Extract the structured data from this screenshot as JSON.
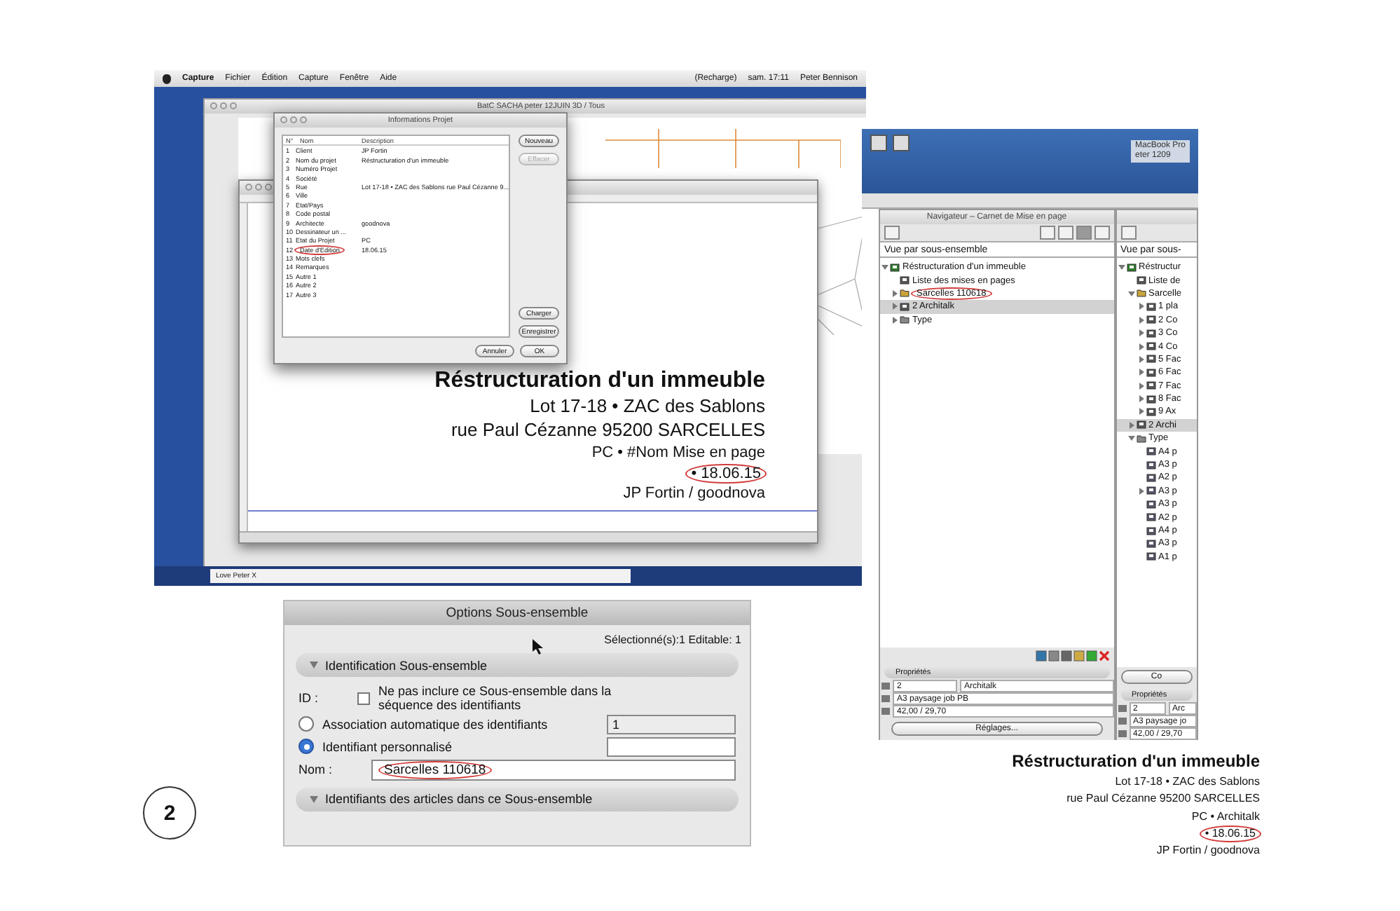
{
  "main_screenshot": {
    "menu_bar": {
      "menus": [
        "Capture",
        "Fichier",
        "Édition",
        "Capture",
        "Fenêtre",
        "Aide"
      ],
      "status": [
        "(Recharge)",
        "sam. 17:11",
        "Peter Bennison"
      ]
    },
    "back_window": {
      "title": "BatC SACHA peter 12JUIN 3D / Tous"
    },
    "info_dialog": {
      "title": "Informations Projet",
      "columns": [
        "N°",
        "Nom",
        "Description"
      ],
      "rows": [
        {
          "number": "1",
          "name": "Client",
          "description": "JP Fortin",
          "circled": false
        },
        {
          "number": "2",
          "name": "Nom du projet",
          "description": "Réstructuration d'un immeuble",
          "circled": false
        },
        {
          "number": "3",
          "name": "Numéro Projet",
          "circled": false
        },
        {
          "number": "4",
          "name": "Société",
          "circled": false
        },
        {
          "number": "5",
          "name": "Rue",
          "description": "Lot 17-18 • ZAC des Sablons rue Paul Cézanne 9...",
          "circled": false
        },
        {
          "number": "6",
          "name": "Ville",
          "circled": false
        },
        {
          "number": "7",
          "name": "Etat/Pays",
          "circled": false
        },
        {
          "number": "8",
          "name": "Code postal",
          "circled": false
        },
        {
          "number": "9",
          "name": "Architecte",
          "description": "goodnova",
          "circled": false
        },
        {
          "number": "10",
          "name": "Dessinateur un ...",
          "circled": false
        },
        {
          "number": "11",
          "name": "Etat du Projet",
          "description": "PC",
          "circled": false
        },
        {
          "number": "12",
          "name": "Date d'Edition",
          "description": "18.06.15",
          "circled": true
        },
        {
          "number": "13",
          "name": "Mots clefs",
          "circled": false
        },
        {
          "number": "14",
          "name": "Remarques",
          "circled": false
        },
        {
          "number": "15",
          "name": "Autre 1",
          "circled": false
        },
        {
          "number": "16",
          "name": "Autre 2",
          "circled": false
        },
        {
          "number": "17",
          "name": "Autre 3",
          "circled": false
        }
      ],
      "side_buttons": [
        {
          "label": "Nouveau",
          "disabled": false
        },
        {
          "label": "Effacer",
          "disabled": true
        }
      ],
      "lower_buttons": [
        {
          "label": "Charger",
          "disabled": false
        },
        {
          "label": "Enregistrer",
          "disabled": false
        }
      ],
      "footer_buttons": [
        {
          "label": "Annuler",
          "disabled": false
        },
        {
          "label": "OK",
          "disabled": false
        }
      ]
    },
    "title_block": [
      {
        "kind": "heading",
        "text": "Réstructuration d'un immeuble",
        "circled": false
      },
      {
        "kind": "line",
        "text": "Lot 17-18 • ZAC des Sablons",
        "circled": false
      },
      {
        "kind": "line",
        "text": "rue Paul Cézanne 95200 SARCELLES",
        "circled": false
      },
      {
        "kind": "small",
        "text": "PC • #Nom Mise en page",
        "circled": false
      },
      {
        "kind": "small",
        "text": "• 18.06.15",
        "circled": true
      },
      {
        "kind": "small",
        "text": "JP Fortin / goodnova",
        "circled": false
      }
    ],
    "dock_label": "Love Peter X"
  },
  "navigator_screenshot": {
    "desktop_label": [
      "MacBook Pro",
      "eter 1209"
    ],
    "navigator": {
      "title": "Navigateur – Carnet de Mise en page",
      "view": "Vue par sous-ensemble",
      "tree": [
        {
          "label": "Réstructuration d'un immeuble",
          "kind": "project",
          "expanded": true,
          "selected": false,
          "circled": false,
          "children": [
            {
              "label": "Liste des mises en pages",
              "kind": "layout",
              "selected": false,
              "circled": false
            },
            {
              "label": "Sarcelles 110618",
              "kind": "subset",
              "expanded": false,
              "selected": false,
              "circled": true
            },
            {
              "label": "2 Architalk",
              "kind": "layout",
              "expanded": false,
              "selected": true,
              "circled": false
            },
            {
              "label": "Type",
              "kind": "folder",
              "expanded": false,
              "selected": false,
              "circled": false
            }
          ]
        }
      ],
      "properties": {
        "title": "Propriétés",
        "number": "2",
        "name": "Architalk",
        "format": "A3 paysage job PB",
        "size": "42,00 / 29,70",
        "button": "Réglages..."
      }
    },
    "second_navigator": {
      "view": "Vue par sous-",
      "tree": [
        {
          "label": "Réstructur",
          "kind": "project",
          "expanded": true,
          "selected": false,
          "circled": false,
          "children": [
            {
              "label": "Liste de",
              "kind": "layout",
              "selected": false,
              "circled": false
            },
            {
              "label": "Sarcelle",
              "kind": "subset",
              "expanded": true,
              "selected": false,
              "circled": false,
              "children": [
                {
                  "label": "1 pla",
                  "kind": "layout",
                  "expanded": false,
                  "selected": false,
                  "circled": false
                },
                {
                  "label": "2 Co",
                  "kind": "layout",
                  "expanded": false,
                  "selected": false,
                  "circled": false
                },
                {
                  "label": "3 Co",
                  "kind": "layout",
                  "expanded": false,
                  "selected": false,
                  "circled": false
                },
                {
                  "label": "4 Co",
                  "kind": "layout",
                  "expanded": false,
                  "selected": false,
                  "circled": false
                },
                {
                  "label": "5 Fac",
                  "kind": "layout",
                  "expanded": false,
                  "selected": false,
                  "circled": false
                },
                {
                  "label": "6 Fac",
                  "kind": "layout",
                  "expanded": false,
                  "selected": false,
                  "circled": false
                },
                {
                  "label": "7 Fac",
                  "kind": "layout",
                  "expanded": false,
                  "selected": false,
                  "circled": false
                },
                {
                  "label": "8 Fac",
                  "kind": "layout",
                  "expanded": false,
                  "selected": false,
                  "circled": false
                },
                {
                  "label": "9 Ax",
                  "kind": "layout",
                  "expanded": false,
                  "selected": false,
                  "circled": false
                }
              ]
            },
            {
              "label": "2 Archi",
              "kind": "layout",
              "expanded": false,
              "selected": true,
              "circled": false
            },
            {
              "label": "Type",
              "kind": "folder",
              "expanded": true,
              "selected": false,
              "circled": false,
              "children": [
                {
                  "label": "A4 p",
                  "kind": "sheet",
                  "selected": false,
                  "circled": false
                },
                {
                  "label": "A3 p",
                  "kind": "sheet",
                  "selected": false,
                  "circled": false
                },
                {
                  "label": "A2 p",
                  "kind": "sheet",
                  "selected": false,
                  "circled": false
                },
                {
                  "label": "A3 p",
                  "kind": "sheet",
                  "expanded": false,
                  "selected": false,
                  "circled": false
                },
                {
                  "label": "A3 p",
                  "kind": "sheet",
                  "selected": false,
                  "circled": false
                },
                {
                  "label": "A2 p",
                  "kind": "sheet",
                  "selected": false,
                  "circled": false
                },
                {
                  "label": "A4 p",
                  "kind": "sheet",
                  "selected": false,
                  "circled": false
                },
                {
                  "label": "A3 p",
                  "kind": "sheet",
                  "selected": false,
                  "circled": false
                },
                {
                  "label": "A1 p",
                  "kind": "sheet",
                  "selected": false,
                  "circled": false
                }
              ]
            }
          ]
        }
      ],
      "button": "Co",
      "properties": {
        "title": "Propriétés",
        "number": "2",
        "name": "Arc",
        "format": "A3 paysage jo",
        "size": "42,00 / 29,70"
      }
    }
  },
  "options_panel": {
    "title": "Options Sous-ensemble",
    "selection_info": "Sélectionné(s):1 Editable: 1",
    "section": "Identification Sous-ensemble",
    "id_label": "ID :",
    "exclude_checkbox": {
      "label": "Ne pas inclure ce Sous-ensemble dans la séquence des identifiants",
      "checked": false
    },
    "options": [
      {
        "label": "Association automatique des identifiants",
        "selected": false,
        "value": "1"
      },
      {
        "label": "Identifiant personnalisé",
        "selected": true
      }
    ],
    "name_label": "Nom :",
    "name_value": "Sarcelles 110618",
    "name_circled": true,
    "next_section": "Identifiants des articles dans ce Sous-ensemble"
  },
  "figure_number": "2",
  "page_title_block": [
    {
      "kind": "heading",
      "text": "Réstructuration d'un immeuble",
      "circled": false
    },
    {
      "kind": "line",
      "text": "Lot 17-18 • ZAC des Sablons",
      "circled": false
    },
    {
      "kind": "line",
      "text": "rue Paul Cézanne 95200 SARCELLES",
      "circled": false
    },
    {
      "kind": "line",
      "text": "PC • Architalk",
      "circled": false
    },
    {
      "kind": "line",
      "text": "• 18.06.15",
      "circled": true
    },
    {
      "kind": "line",
      "text": "JP Fortin / goodnova",
      "circled": false
    }
  ]
}
